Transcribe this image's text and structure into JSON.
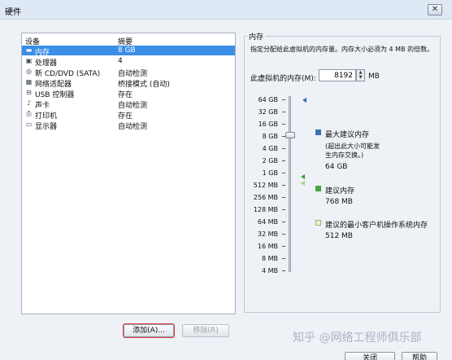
{
  "window": {
    "title": "硬件",
    "close_glyph": "✕"
  },
  "device_list": {
    "headers": {
      "device": "设备",
      "summary": "摘要"
    },
    "rows": [
      {
        "icon": "memory-icon",
        "name": "内存",
        "summary": "8 GB",
        "selected": true
      },
      {
        "icon": "processor-icon",
        "name": "处理器",
        "summary": "4"
      },
      {
        "icon": "cd-dvd-icon",
        "name": "新 CD/DVD (SATA)",
        "summary": "自动检测"
      },
      {
        "icon": "network-adapter-icon",
        "name": "网络适配器",
        "summary": "桥接模式 (自动)"
      },
      {
        "icon": "usb-icon",
        "name": "USB 控制器",
        "summary": "存在"
      },
      {
        "icon": "sound-card-icon",
        "name": "声卡",
        "summary": "自动检测"
      },
      {
        "icon": "printer-icon",
        "name": "打印机",
        "summary": "存在"
      },
      {
        "icon": "display-icon",
        "name": "显示器",
        "summary": "自动检测"
      }
    ]
  },
  "buttons": {
    "add": "添加(A)...",
    "remove": "移除(R)",
    "ok": "关闭",
    "help": "帮助"
  },
  "memory": {
    "section_title": "内存",
    "description": "指定分配给此虚拟机的内存量。内存大小必须为 4 MB 的倍数。",
    "input_label": "此虚拟机的内存(M):",
    "value": "8192",
    "unit": "MB",
    "scale": [
      "64 GB",
      "32 GB",
      "16 GB",
      "8 GB",
      "4 GB",
      "2 GB",
      "1 GB",
      "512 MB",
      "256 MB",
      "128 MB",
      "64 MB",
      "32 MB",
      "16 MB",
      "8 MB",
      "4 MB"
    ],
    "current_value_label": "8 GB",
    "legend": {
      "max": {
        "label": "最大建议内存",
        "note": "(超出此大小可能发生内存交换。)",
        "value": "64 GB"
      },
      "recommended": {
        "label": "建议内存",
        "value": "768 MB"
      },
      "min_guest": {
        "label": "建议的最小客户机操作系统内存",
        "value": "512 MB"
      }
    }
  },
  "watermark": "知乎 @网络工程师俱乐部"
}
